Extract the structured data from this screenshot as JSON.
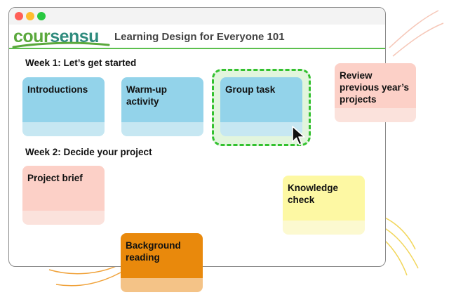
{
  "window": {
    "traffic_lights": [
      "close",
      "minimize",
      "zoom"
    ]
  },
  "header": {
    "logo_part1": "cour",
    "logo_part2": "sensu",
    "course_title": "Learning Design for Everyone 101"
  },
  "weeks": [
    {
      "heading": "Week 1: Let’s get started",
      "cards": [
        {
          "label": "Introductions",
          "color": "blue"
        },
        {
          "label": "Warm-up activity",
          "color": "blue"
        },
        {
          "label": "Group task",
          "color": "blue",
          "selected": true
        }
      ]
    },
    {
      "heading": "Week 2: Decide your project",
      "cards": [
        {
          "label": "Project brief",
          "color": "pink"
        }
      ]
    }
  ],
  "floating_cards": [
    {
      "label": "Review previous year’s projects",
      "color": "pink"
    },
    {
      "label": "Knowledge check",
      "color": "yellow"
    },
    {
      "label": "Background reading",
      "color": "orange"
    }
  ],
  "colors": {
    "blue": "#93d3ea",
    "pink": "#fcd0c7",
    "yellow": "#fdf8a3",
    "orange": "#e9890c",
    "brand_green": "#5cbf4e",
    "selection_green": "#33c12f"
  },
  "icons": {
    "cursor": "arrow-pointer-icon",
    "logo_swoosh": "swoosh-icon"
  }
}
